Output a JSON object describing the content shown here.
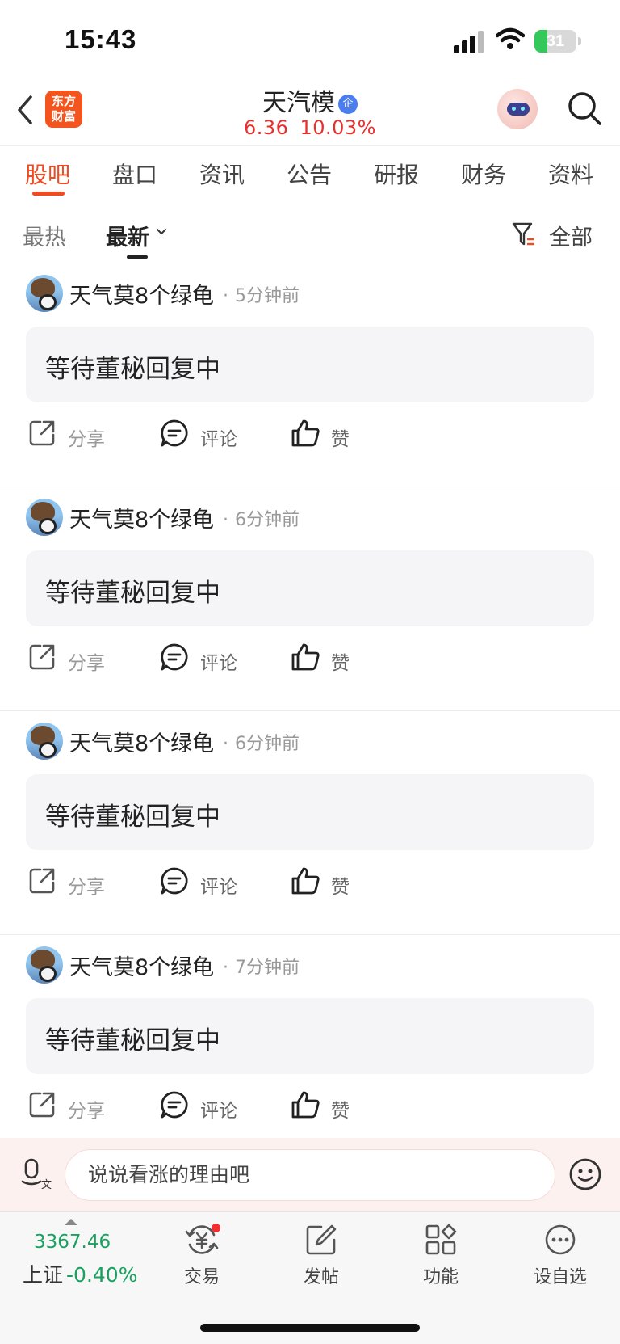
{
  "status_bar": {
    "time": "15:43",
    "battery": "31"
  },
  "header": {
    "app_logo": [
      "东方",
      "财富"
    ],
    "stock_name": "天汽模",
    "badge": "企",
    "price": "6.36",
    "change_pct": "10.03%"
  },
  "tabs": [
    "股吧",
    "盘口",
    "资讯",
    "公告",
    "研报",
    "财务",
    "资料"
  ],
  "filter": {
    "hot": "最热",
    "latest": "最新",
    "scope": "全部"
  },
  "posts": [
    {
      "author": "天气莫8个绿龟",
      "time": "5分钟前",
      "content": "等待董秘回复中"
    },
    {
      "author": "天气莫8个绿龟",
      "time": "6分钟前",
      "content": "等待董秘回复中"
    },
    {
      "author": "天气莫8个绿龟",
      "time": "6分钟前",
      "content": "等待董秘回复中"
    },
    {
      "author": "天气莫8个绿龟",
      "time": "7分钟前",
      "content": "等待董秘回复中"
    }
  ],
  "actions": {
    "share": "分享",
    "comment": "评论",
    "like": "赞"
  },
  "comment_bar": {
    "placeholder": "说说看涨的理由吧"
  },
  "bottom_nav": {
    "index_value": "3367.46",
    "index_name": "上证",
    "index_change": "-0.40%",
    "items": [
      "交易",
      "发帖",
      "功能",
      "设自选"
    ]
  },
  "colors": {
    "accent": "#f04a22",
    "up": "#e8302f",
    "down": "#19a15f"
  }
}
